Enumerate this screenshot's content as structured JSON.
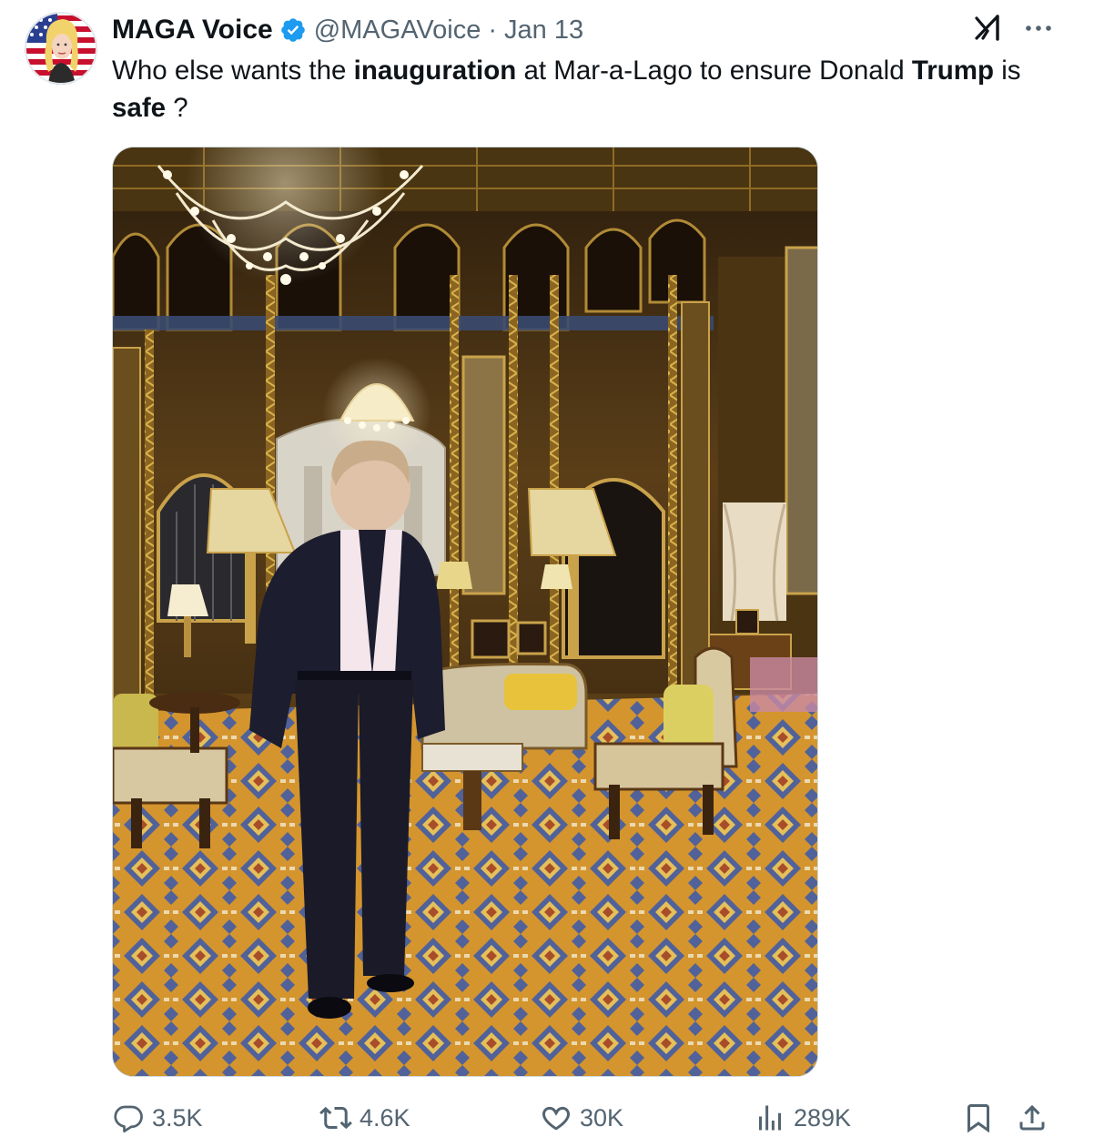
{
  "author": {
    "display_name": "MAGA Voice",
    "handle": "@MAGAVoice",
    "separator": "·",
    "date": "Jan 13"
  },
  "icons": {
    "avatar": "avatar-cartoon-woman-american-flag",
    "verified": "verified-badge-icon",
    "grok": "grok-icon",
    "more": "more-icon",
    "reply": "reply-icon",
    "retweet": "retweet-icon",
    "like": "heart-icon",
    "views": "views-icon",
    "bookmark": "bookmark-icon",
    "share": "share-icon"
  },
  "colors": {
    "text": "#0f1419",
    "secondary": "#536471",
    "verified": "#1d9bf0"
  },
  "tweet": {
    "text_parts": [
      "Who else wants the ",
      "inauguration",
      " at Mar-a-Lago to ensure Donald ",
      "Trump",
      " is ",
      "safe",
      " ?"
    ]
  },
  "media": {
    "kind": "photo"
  },
  "metrics": {
    "replies": "3.5K",
    "retweets": "4.6K",
    "likes": "30K",
    "views": "289K"
  }
}
